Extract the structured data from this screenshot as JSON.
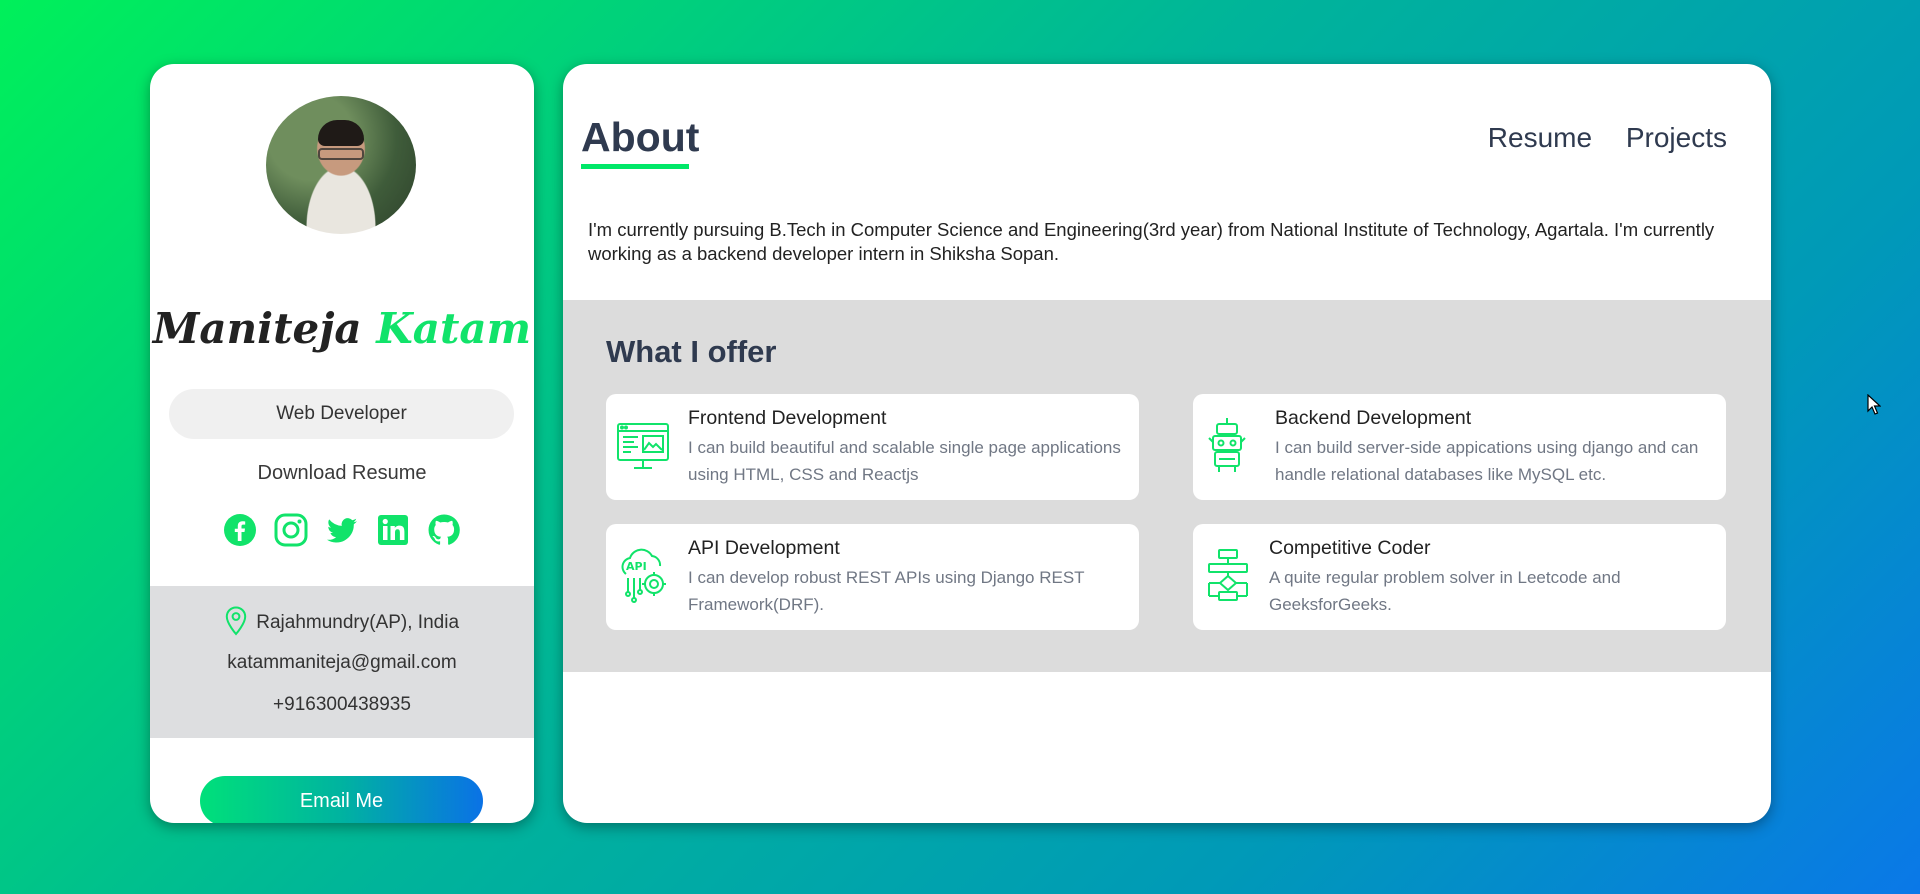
{
  "profile": {
    "first_name": "Maniteja",
    "last_name": "Katam",
    "role": "Web Developer",
    "download_label": "Download Resume",
    "socials": [
      "facebook-icon",
      "instagram-icon",
      "twitter-icon",
      "linkedin-icon",
      "github-icon"
    ],
    "location": "Rajahmundry(AP), India",
    "email": "katammaniteja@gmail.com",
    "phone": "+916300438935",
    "email_button": "Email Me"
  },
  "nav": {
    "title": "About",
    "links": [
      "Resume",
      "Projects"
    ]
  },
  "about": {
    "text": "I'm currently pursuing B.Tech in Computer Science and Engineering(3rd year) from National Institute of Technology, Agartala. I'm currently working as a backend developer intern in Shiksha Sopan."
  },
  "offer": {
    "title": "What I offer",
    "items": [
      {
        "title": "Frontend Development",
        "desc": "I can build beautiful and scalable single page applications using HTML, CSS and Reactjs",
        "icon": "frontend-icon"
      },
      {
        "title": "Backend Development",
        "desc": "I can build server-side appications using django and can handle relational databases like MySQL etc.",
        "icon": "backend-icon"
      },
      {
        "title": "API Development",
        "desc": "I can develop robust REST APIs using Django REST Framework(DRF).",
        "icon": "api-icon"
      },
      {
        "title": "Competitive Coder",
        "desc": "A quite regular problem solver in Leetcode and GeeksforGeeks.",
        "icon": "flowchart-icon"
      }
    ]
  },
  "colors": {
    "accent": "#00e868",
    "heading": "#2f3a4f",
    "panel_gray": "#dcdcdc"
  }
}
